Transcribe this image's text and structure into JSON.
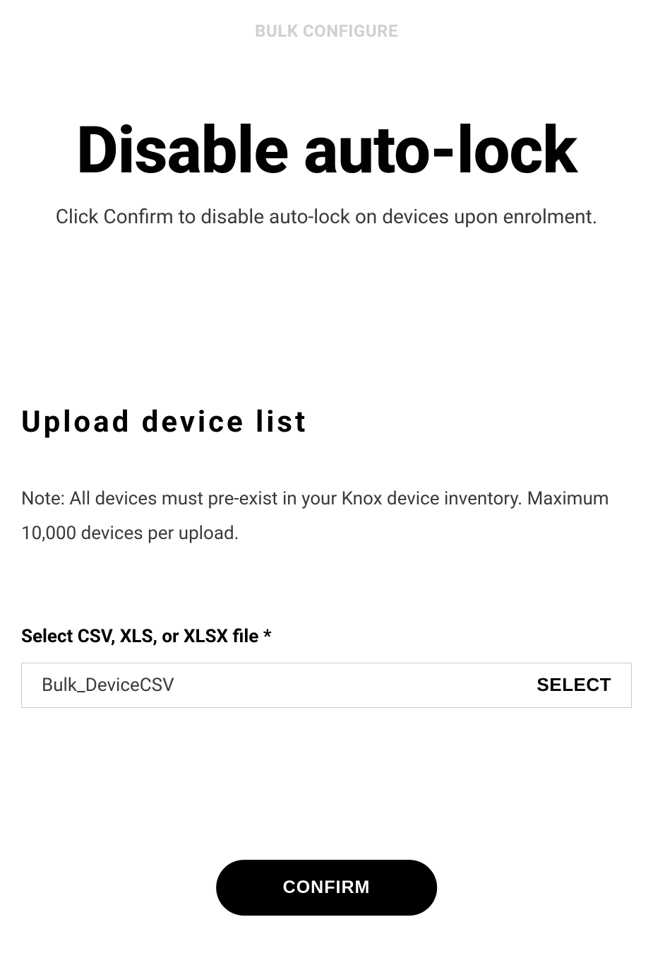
{
  "header": {
    "label": "BULK CONFIGURE"
  },
  "title": {
    "main": "Disable auto-lock",
    "subtitle": "Click Confirm to disable auto-lock on devices upon enrolment."
  },
  "upload": {
    "heading": "Upload device list",
    "note": "Note: All devices must pre-exist in your Knox device inventory. Maximum 10,000 devices per upload.",
    "field_label": "Select CSV, XLS, or XLSX file *",
    "file_name": "Bulk_DeviceCSV",
    "select_button": "SELECT"
  },
  "actions": {
    "confirm": "CONFIRM"
  }
}
